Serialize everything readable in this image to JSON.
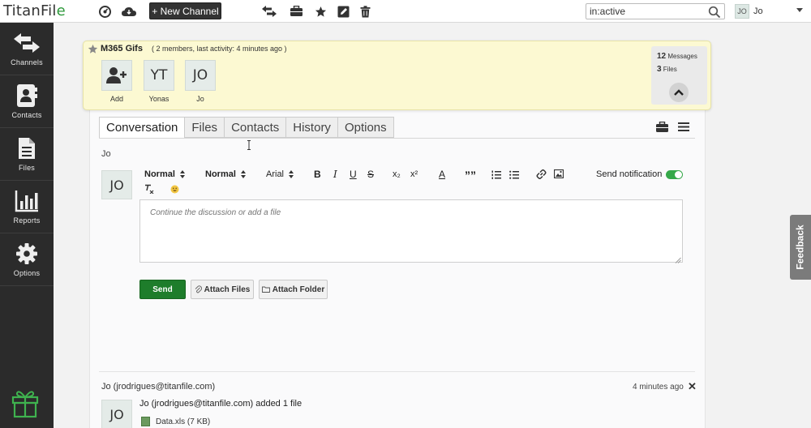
{
  "app": {
    "logo_text_a": "TitanFil",
    "logo_text_b": "e"
  },
  "topbar": {
    "new_channel_label": "+ New Channel",
    "search_value": "in:active",
    "user_initials": "JO",
    "user_name": "Jo"
  },
  "sidebar": {
    "items": [
      {
        "label": "Channels",
        "icon": "channels-arrows-icon"
      },
      {
        "label": "Contacts",
        "icon": "contacts-book-icon"
      },
      {
        "label": "Files",
        "icon": "file-icon"
      },
      {
        "label": "Reports",
        "icon": "bar-chart-icon"
      },
      {
        "label": "Options",
        "icon": "gear-icon"
      }
    ]
  },
  "channel": {
    "title": "M365 Gifs",
    "meta": "( 2 members, last activity: 4 minutes ago )",
    "members": [
      {
        "initials": "",
        "name": "Add"
      },
      {
        "initials": "YT",
        "name": "Yonas"
      },
      {
        "initials": "JO",
        "name": "Jo"
      }
    ],
    "stats": {
      "messages_count": "12",
      "messages_label": "Messages",
      "files_count": "3",
      "files_label": "Files"
    }
  },
  "tabs": [
    "Conversation",
    "Files",
    "Contacts",
    "History",
    "Options"
  ],
  "composer": {
    "to": "Jo",
    "avatar": "JO",
    "toolbar": {
      "heading_1": "Normal",
      "heading_2": "Normal",
      "font": "Arial",
      "bold": "B",
      "italic": "I",
      "underline": "U",
      "strike": "S",
      "subscript": "x₂",
      "superscript": "x²",
      "color": "A",
      "quote": "””"
    },
    "notify_label": "Send notification",
    "notify_on": true,
    "placeholder": "Continue the discussion or add a file",
    "send_label": "Send",
    "attach_files_label": "Attach Files",
    "attach_folder_label": "Attach Folder"
  },
  "message": {
    "author": "Jo (jrodrigues@titanfile.com)",
    "time": "4 minutes ago",
    "avatar": "JO",
    "text": "Jo (jrodrigues@titanfile.com) added 1 file",
    "file": "Data.xls (7 KB)"
  },
  "feedback_label": "Feedback",
  "colors": {
    "sidebar_bg": "#2b2b2b",
    "header_bg": "#fcf9d2",
    "send_green": "#1e7d2b",
    "logo_green": "#2f9a3c",
    "toggle_green": "#36a84a"
  }
}
